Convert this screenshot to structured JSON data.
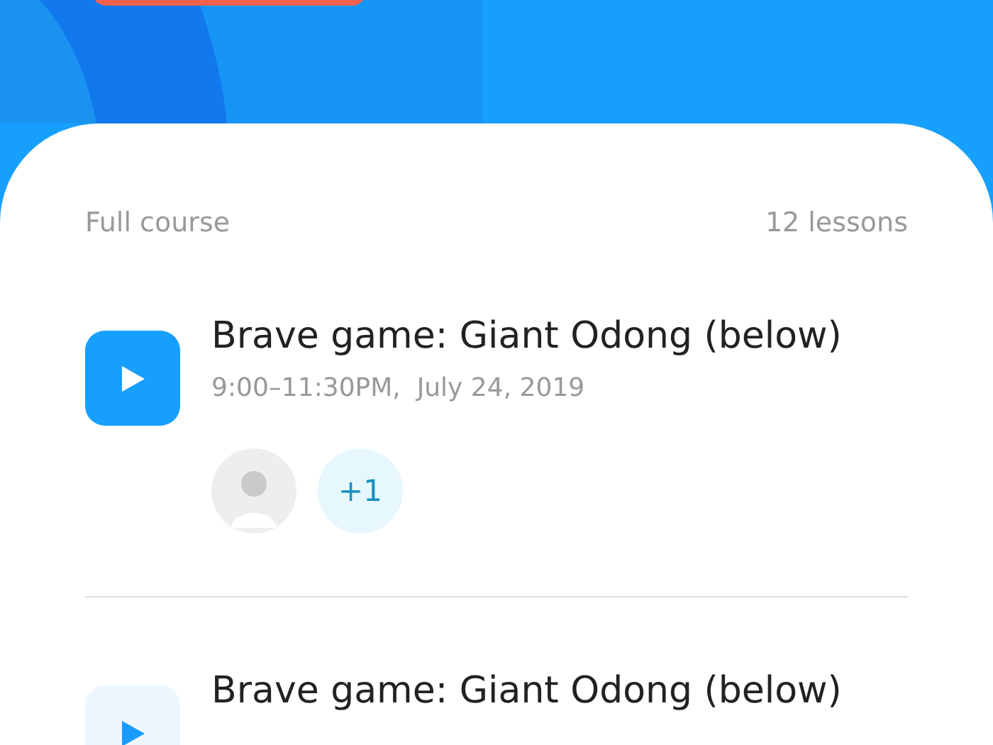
{
  "course": {
    "label": "Full course",
    "count": "12 lessons"
  },
  "lessons": [
    {
      "title": "Brave game: Giant Odong (below)",
      "time": "9:00–11:30PM,  July 24, 2019",
      "active": true,
      "participants": {
        "avatar": true,
        "extra": "+1"
      }
    },
    {
      "title": "Brave game: Giant Odong (below)",
      "active": false
    }
  ]
}
